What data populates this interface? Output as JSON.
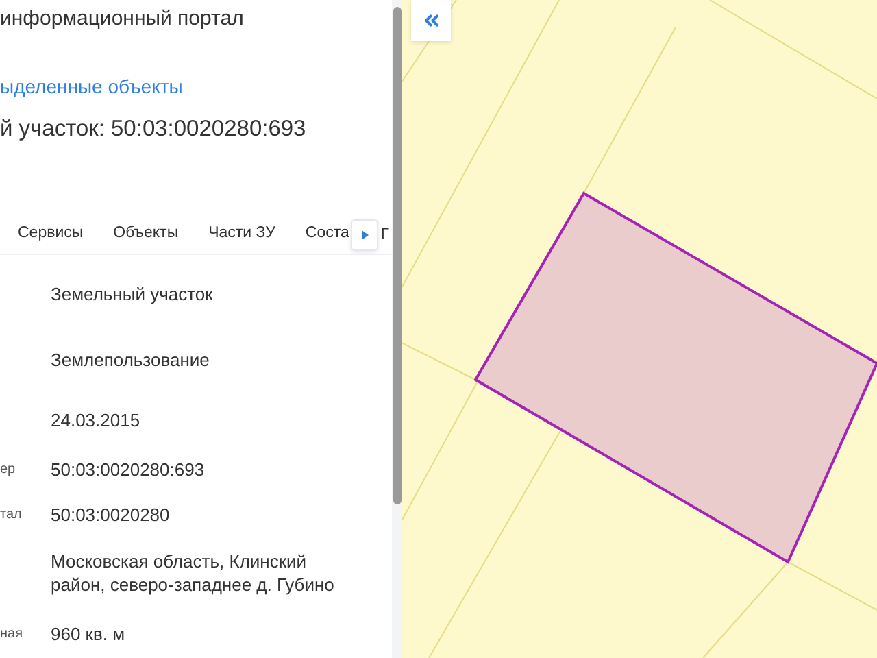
{
  "header": {
    "portal_title": "информационный портал",
    "link": "ыделенные объекты",
    "object_title": "й участок: 50:03:0020280:693"
  },
  "tabs": [
    {
      "label": "Сервисы",
      "selected": false
    },
    {
      "label": "Объекты",
      "selected": false
    },
    {
      "label": "Части ЗУ",
      "selected": false
    },
    {
      "label": "Соста",
      "selected": false
    }
  ],
  "tab_overflow_label": "Г",
  "details": [
    {
      "value": "Земельный участок"
    },
    {
      "value": "Землепользование"
    },
    {
      "value": "24.03.2015"
    },
    {
      "label": "ер",
      "value": "50:03:0020280:693"
    },
    {
      "label": "тал",
      "value": "50:03:0020280"
    },
    {
      "value": "Московская область, Клинский район, северо-западнее д. Губино"
    },
    {
      "label": "ная",
      "value": "960 кв. м"
    }
  ]
}
